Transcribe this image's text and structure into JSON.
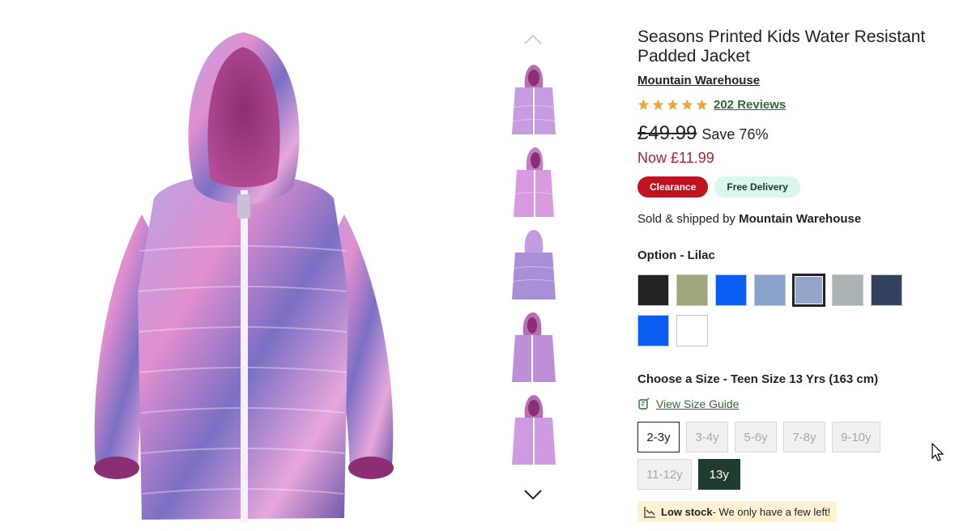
{
  "product": {
    "title": "Seasons Printed Kids Water Resistant Padded Jacket",
    "brand": "Mountain Warehouse",
    "rating": 5,
    "reviews_label": "202 Reviews",
    "old_price": "£49.99",
    "save_label": "Save 76%",
    "now_price": "Now £11.99",
    "badges": {
      "clearance": "Clearance",
      "delivery": "Free Delivery"
    },
    "sold_by_prefix": "Sold & shipped by",
    "sold_by_name": "Mountain Warehouse"
  },
  "gallery": {
    "up_icon": "chevron-up-icon",
    "down_icon": "chevron-down-icon",
    "thumbnail_count": 5
  },
  "option": {
    "label": "Option - Lilac",
    "colors": [
      "#222222",
      "#a1a77c",
      "#0b5cf0",
      "#8aa1ca",
      "#95a5c9",
      "#aab4b4",
      "#33415c",
      "#0b5cf0",
      "#ffffff"
    ],
    "selected_index": 4
  },
  "size": {
    "label": "Choose a Size - Teen Size 13 Yrs (163 cm)",
    "guide_link": "View Size Guide",
    "options": [
      "2-3y",
      "3-4y",
      "5-6y",
      "7-8y",
      "9-10y",
      "11-12y",
      "13y"
    ],
    "available": [
      "2-3y",
      "13y"
    ],
    "selected": "13y"
  },
  "stock": {
    "title": "Low stock",
    "message": " - We only have a few left!"
  },
  "colors": {
    "accent_green": "#2e6b32",
    "sale_red": "#b11f2b",
    "clearance_red": "#c1121f",
    "star": "#f0a531",
    "size_selected": "#1f3d2c"
  }
}
